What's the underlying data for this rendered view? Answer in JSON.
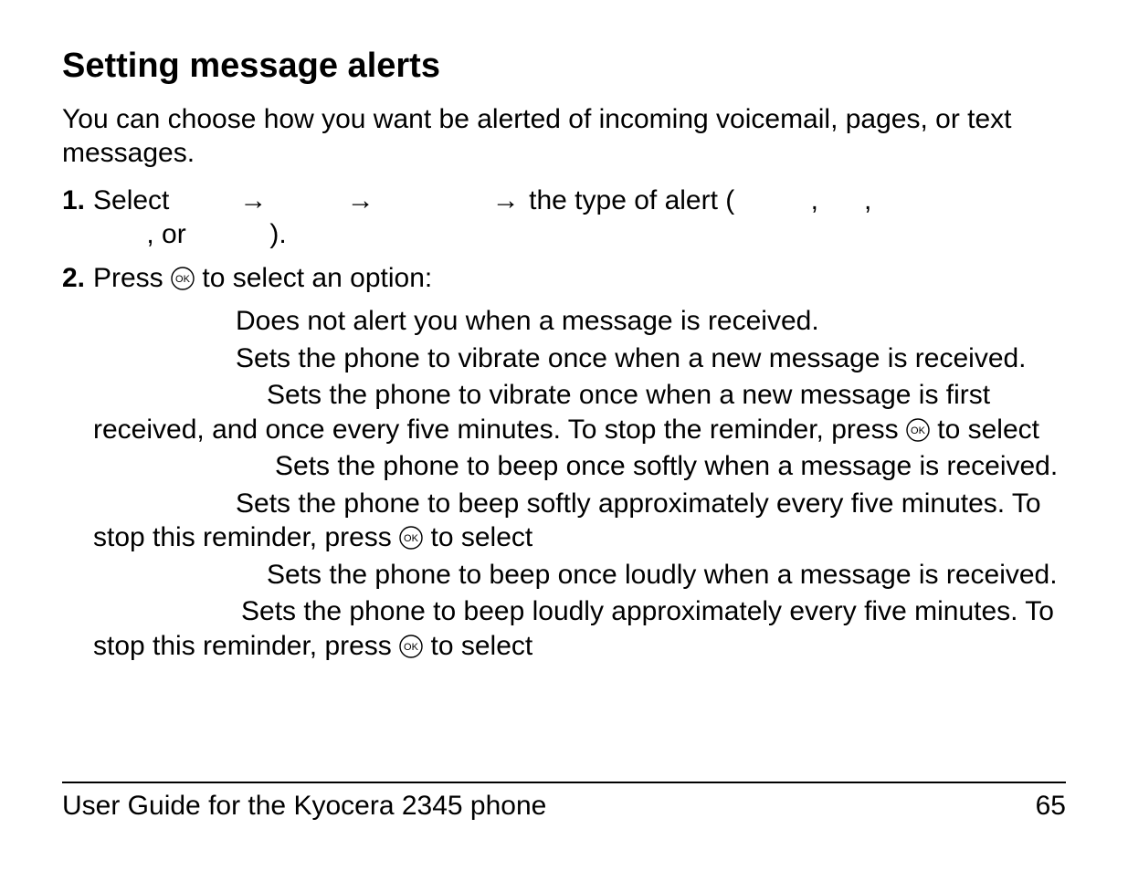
{
  "heading": "Setting message alerts",
  "intro": "You can choose how you want be alerted of incoming voicemail, pages, or text messages.",
  "steps": {
    "s1": {
      "num": "1.",
      "lead": "Select ",
      "mid": " the type of alert (",
      "tail_or": ", or",
      "tail_close": ")."
    },
    "s2": {
      "num": "2.",
      "lead": "Press ",
      "tail": " to select an option:"
    }
  },
  "glyphs": {
    "arrow": "→",
    "comma": ",",
    "ok_label": "OK"
  },
  "options": {
    "o1": "Does not alert you when a message is received.",
    "o2": "Sets the phone to vibrate once when a new message is received.",
    "o3a": "Sets the phone to vibrate once when a new message is first received, and once every five minutes. To stop the reminder, press ",
    "o3b": " to select",
    "o4": "Sets the phone to beep once softly when a message is received.",
    "o5a": "Sets the phone to beep softly approximately every five minutes. To stop this reminder, press ",
    "o5b": " to select",
    "o6": "Sets the phone to beep once loudly when a message is received.",
    "o7a": "Sets the phone to beep loudly approximately every five minutes. To stop this reminder, press ",
    "o7b": " to select"
  },
  "footer": {
    "left": "User Guide for the Kyocera 2345 phone",
    "right": "65"
  }
}
